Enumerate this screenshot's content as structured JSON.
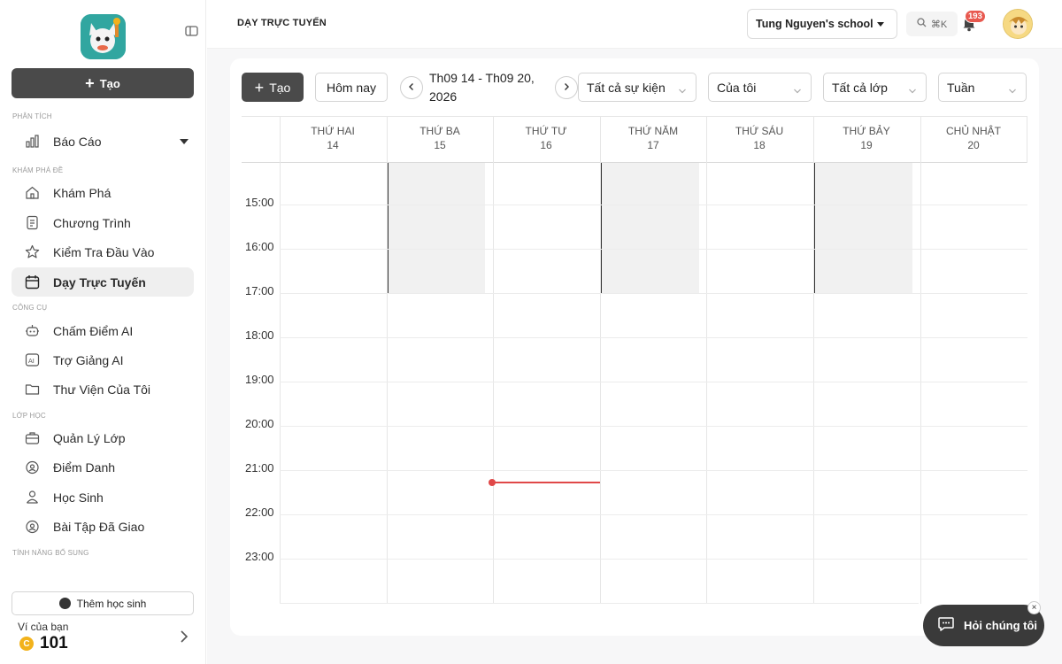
{
  "sidebar": {
    "create_label": "Tạo",
    "sections": {
      "analysis": "PHÂN TÍCH",
      "explore": "KHÁM PHÁ ĐỀ",
      "tools": "CÔNG CỤ",
      "classes": "LỚP HỌC",
      "extras": "TÍNH NĂNG BỔ SUNG"
    },
    "items": {
      "reports": "Báo Cáo",
      "explore": "Khám Phá",
      "program": "Chương Trình",
      "entry_test": "Kiểm Tra Đầu Vào",
      "online_teaching": "Dạy Trực Tuyến",
      "ai_grading": "Chấm Điểm AI",
      "ai_assistant": "Trợ Giảng AI",
      "my_library": "Thư Viện Của Tôi",
      "class_management": "Quản Lý Lớp",
      "attendance": "Điểm Danh",
      "students": "Học Sinh",
      "assigned_homework": "Bài Tập Đã Giao"
    },
    "add_student": "Thêm học sinh",
    "wallet_label": "Ví của bạn",
    "wallet_amount": "101",
    "coin_symbol": "C"
  },
  "header": {
    "page_title": "DẠY TRỰC TUYẾN",
    "school": "Tung Nguyen's school",
    "search_shortcut": "⌘K",
    "notification_count": "193"
  },
  "toolbar": {
    "create_label": "Tạo",
    "today_label": "Hôm nay",
    "date_range": "Th09 14 - Th09 20, 2026",
    "filters": {
      "events": "Tất cả sự kiện",
      "owner": "Của tôi",
      "classes": "Tất cả lớp",
      "view": "Tuần"
    }
  },
  "calendar": {
    "days": [
      {
        "name": "THỨ HAI",
        "date": "14"
      },
      {
        "name": "THỨ BA",
        "date": "15"
      },
      {
        "name": "THỨ TƯ",
        "date": "16"
      },
      {
        "name": "THỨ NĂM",
        "date": "17"
      },
      {
        "name": "THỨ SÁU",
        "date": "18"
      },
      {
        "name": "THỨ BẢY",
        "date": "19"
      },
      {
        "name": "CHỦ NHẬT",
        "date": "20"
      }
    ],
    "hours": [
      "15:00",
      "16:00",
      "17:00",
      "18:00",
      "19:00",
      "20:00",
      "21:00",
      "22:00",
      "23:00"
    ]
  },
  "help": {
    "label": "Hỏi chúng tôi",
    "close": "×"
  },
  "colors": {
    "dark_button": "#4a4a4a",
    "now_indicator": "#e04848",
    "badge": "#e8594f",
    "coin": "#f2b21b"
  }
}
